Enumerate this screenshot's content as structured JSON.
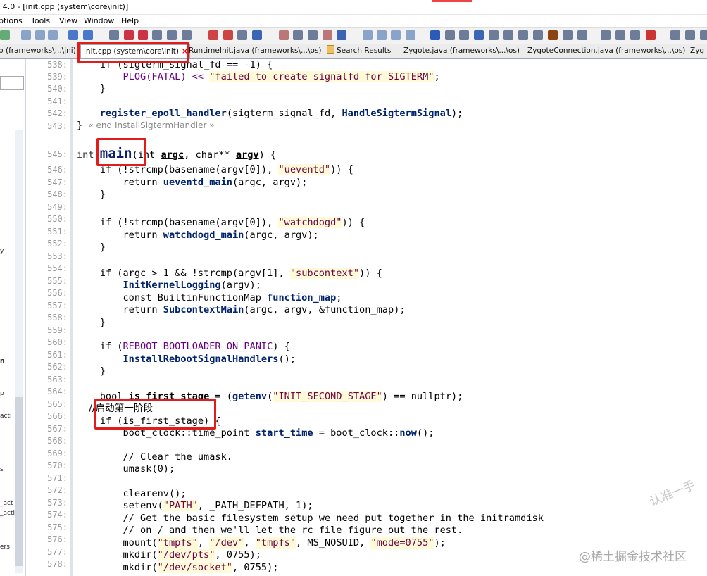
{
  "window": {
    "title": "t 4.0 - [init.cpp (system\\core\\init)]"
  },
  "menu": {
    "items": [
      "ptions",
      "Tools",
      "View",
      "Window",
      "Help"
    ]
  },
  "tabs": [
    {
      "label": "p (frameworks\\...\\jni)",
      "active": false
    },
    {
      "label": "init.cpp (system\\core\\init)",
      "active": true,
      "close": "×"
    },
    {
      "label": "RuntimeInit.java (frameworks\\...\\os)",
      "active": false
    },
    {
      "label": "Search Results",
      "active": false
    },
    {
      "label": "Zygote.java (frameworks\\...\\os)",
      "active": false
    },
    {
      "label": "ZygoteConnection.java (frameworks\\...\\os)",
      "active": false
    },
    {
      "label": "Zyg",
      "active": false
    }
  ],
  "left_panel": {
    "labels": [
      "y",
      "n",
      "p",
      "acti",
      "s",
      "_act",
      "_acti",
      "ers"
    ]
  },
  "editor": {
    "line_numbers": [
      "538:",
      "539:",
      "540:",
      "541:",
      "542:",
      "543:",
      "",
      "545:",
      "546:",
      "547:",
      "548:",
      "549:",
      "550:",
      "551:",
      "552:",
      "553:",
      "554:",
      "555:",
      "556:",
      "557:",
      "558:",
      "559:",
      "560:",
      "561:",
      "562:",
      "563:",
      "564:",
      "565:",
      "566:",
      "567:",
      "568:",
      "569:",
      "570:",
      "571:",
      "572:",
      "573:",
      "574:",
      "575:",
      "576:",
      "577:",
      "578:"
    ],
    "lines": {
      "l538": "    if (sigterm_signal_fd == -1) {",
      "l539a": "        PLOG(FATAL) << ",
      "l539b": "\"failed to create signalfd for SIGTERM\"",
      "l539c": ";",
      "l540": "    }",
      "l542a": "    ",
      "l542b": "register_epoll_handler",
      "l542c": "(sigterm_signal_fd, ",
      "l542d": "HandleSigtermSignal",
      "l542e": ");",
      "l543a": "} ",
      "l543b": "« end InstallSigtermHandler »",
      "l545a": "int ",
      "l545b": "main",
      "l545c": "(int ",
      "l545d": "argc",
      "l545e": ", char** ",
      "l545f": "argv",
      "l545g": ") {",
      "l546a": "    if (!strcmp(basename(argv[0]), ",
      "l546b": "\"ueventd\"",
      "l546c": ")) {",
      "l547a": "        return ",
      "l547b": "ueventd_main",
      "l547c": "(argc, argv);",
      "l548": "    }",
      "l550a": "    if (!strcmp(basename(argv[0]), ",
      "l550b": "\"watchdogd\"",
      "l550c": ")) {",
      "l551a": "        return ",
      "l551b": "watchdogd_main",
      "l551c": "(argc, argv);",
      "l552": "    }",
      "l554a": "    if (argc > 1 && !strcmp(argv[1], ",
      "l554b": "\"subcontext\"",
      "l554c": ")) {",
      "l555a": "        ",
      "l555b": "InitKernelLogging",
      "l555c": "(argv);",
      "l556a": "        const BuiltinFunctionMap ",
      "l556b": "function_map",
      "l556c": ";",
      "l557a": "        return ",
      "l557b": "SubcontextMain",
      "l557c": "(argc, argv, &function_map);",
      "l558": "    }",
      "l560a": "    if (",
      "l560b": "REBOOT_BOOTLOADER_ON_PANIC",
      "l560c": ") {",
      "l561a": "        ",
      "l561b": "InstallRebootSignalHandlers",
      "l561c": "();",
      "l562": "    }",
      "l564a": "    bool ",
      "l564b": "is_first_stage",
      "l564c": " = (",
      "l564d": "getenv",
      "l564e": "(",
      "l564f": "\"INIT_SECOND_STAGE\"",
      "l564g": ") == nullptr);",
      "l565": "    //启动第一阶段",
      "l566": "    if (is_first_stage) {",
      "l567a": "        boot_clock::time_point ",
      "l567b": "start_time",
      "l567c": " = boot_clock::",
      "l567d": "now",
      "l567e": "();",
      "l569": "        // Clear the umask.",
      "l570": "        umask(0);",
      "l572": "        clearenv();",
      "l573a": "        setenv(",
      "l573b": "\"PATH\"",
      "l573c": ", _PATH_DEFPATH, 1);",
      "l574": "        // Get the basic filesystem setup we need put together in the initramdisk",
      "l575": "        // on / and then we'll let the rc file figure out the rest.",
      "l576a": "        mount(",
      "l576b": "\"tmpfs\"",
      "l576c": ", ",
      "l576d": "\"/dev\"",
      "l576e": ", ",
      "l576f": "\"tmpfs\"",
      "l576g": ", MS_NOSUID, ",
      "l576h": "\"mode=0755\"",
      "l576i": ");",
      "l577a": "        mkdir(",
      "l577b": "\"/dev/pts\"",
      "l577c": ", 0755);",
      "l578a": "        mkdir(",
      "l578b": "\"/dev/socket\"",
      "l578c": ", 0755);"
    }
  },
  "watermarks": {
    "diagonal": "认准一手",
    "bottom": "@稀土掘金技术社区"
  },
  "colors": {
    "annotation_red": "#e21b1b",
    "string_bg": "#fffbd8"
  }
}
